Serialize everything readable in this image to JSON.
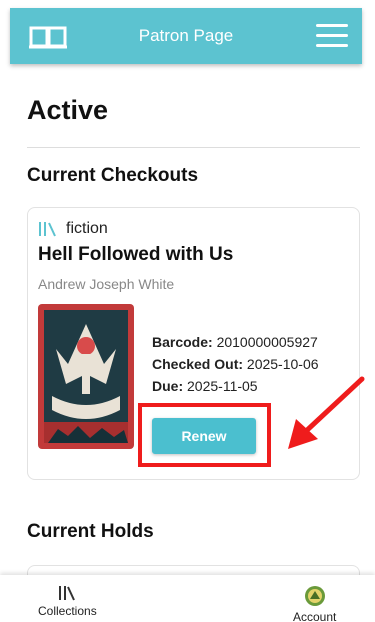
{
  "header": {
    "title": "Patron Page",
    "icons": {
      "left": "book-icon",
      "right": "menu-icon"
    }
  },
  "page": {
    "title": "Active"
  },
  "checkouts": {
    "section_title": "Current Checkouts",
    "items": [
      {
        "genre": "fiction",
        "title": "Hell Followed with Us",
        "author": "Andrew Joseph White",
        "barcode_label": "Barcode:",
        "barcode": "2010000005927",
        "checked_out_label": "Checked Out:",
        "checked_out": "2025-10-06",
        "due_label": "Due:",
        "due": "2025-11-05",
        "renew_label": "Renew"
      }
    ]
  },
  "holds": {
    "section_title": "Current Holds"
  },
  "bottom_nav": {
    "collections_label": "Collections",
    "account_label": "Account"
  },
  "colors": {
    "accent": "#5cc3d0",
    "button": "#4bbfcf",
    "highlight": "#ef1c1c"
  }
}
